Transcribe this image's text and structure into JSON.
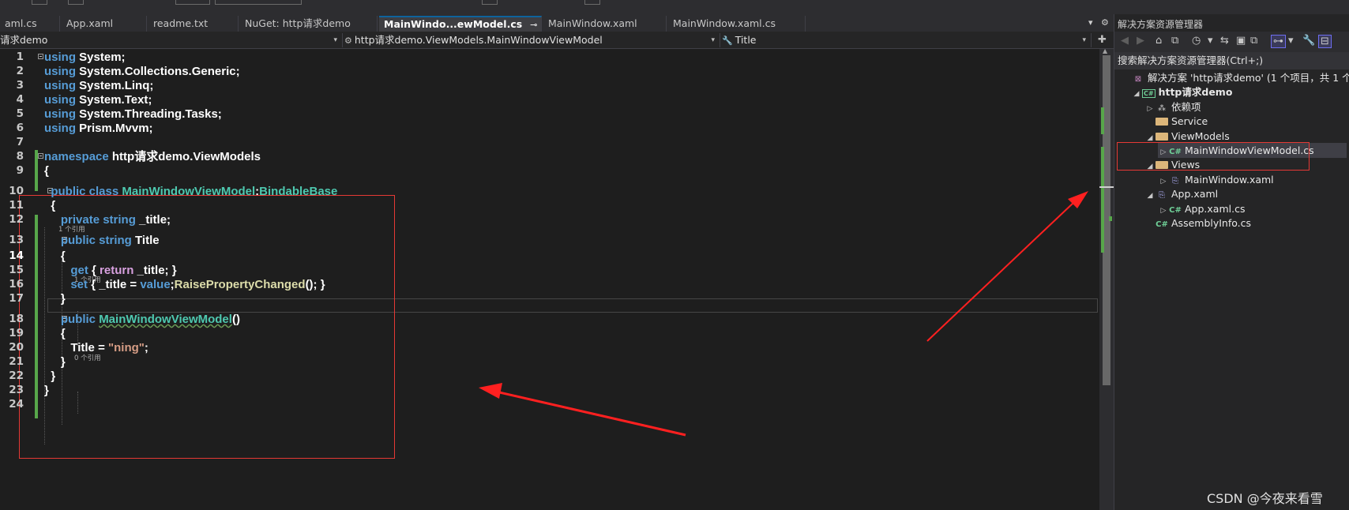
{
  "tabs": [
    {
      "label": "aml.cs",
      "active": false
    },
    {
      "label": "App.xaml",
      "active": false
    },
    {
      "label": "readme.txt",
      "active": false
    },
    {
      "label": "NuGet: http请求demo",
      "active": false
    },
    {
      "label": "MainWindo...ewModel.cs",
      "active": true
    },
    {
      "label": "MainWindow.xaml",
      "active": false
    },
    {
      "label": "MainWindow.xaml.cs",
      "active": false
    }
  ],
  "tab_controls": {
    "pin": "⊸",
    "close": "✕",
    "menu": "▾",
    "settings": "⚙"
  },
  "navbar": {
    "project": "请求demo",
    "class": "http请求demo.ViewModels.MainWindowViewModel",
    "member": "Title",
    "class_icon": "⚙",
    "member_icon": "🔧",
    "caret": "▾",
    "split": "✚"
  },
  "code_lines": [
    {
      "n": "1",
      "html": "<span class=\"kw\">using</span> System;"
    },
    {
      "n": "2",
      "html": "<span class=\"kw\">using</span> System.Collections.Generic;"
    },
    {
      "n": "3",
      "html": "<span class=\"kw\">using</span> System.Linq;"
    },
    {
      "n": "4",
      "html": "<span class=\"kw\">using</span> System.Text;"
    },
    {
      "n": "5",
      "html": "<span class=\"kw\">using</span> System.Threading.Tasks;"
    },
    {
      "n": "6",
      "html": "<span class=\"kw\">using</span> Prism.Mvvm;"
    },
    {
      "n": "7",
      "html": ""
    },
    {
      "n": "8",
      "html": "<span class=\"kw\">namespace</span> http请求demo.ViewModels"
    },
    {
      "n": "9",
      "html": "{"
    },
    {
      "n": "10",
      "html": "  <span class=\"kw\">public class</span> <span class=\"ty\">MainWindowViewModel</span>:<span class=\"ty\">BindableBase</span>"
    },
    {
      "n": "11",
      "html": "  {"
    },
    {
      "n": "12",
      "html": "     <span class=\"kw\">private string</span> _title;"
    },
    {
      "n": "13",
      "html": "     <span class=\"kw\">public string</span> Title"
    },
    {
      "n": "14",
      "html": "     {"
    },
    {
      "n": "15",
      "html": "        <span class=\"kw\">get</span> { <span class=\"kw2\">return</span> _title; }"
    },
    {
      "n": "16",
      "html": "        <span class=\"kw\">set</span> { _title = <span class=\"kw\">value</span>;<span class=\"fn\">RaisePropertyChanged</span>(); }"
    },
    {
      "n": "17",
      "html": "     }"
    },
    {
      "n": "18",
      "html": "     <span class=\"kw\">public</span> <span class=\"ty squig\">MainWindowViewModel</span>()"
    },
    {
      "n": "19",
      "html": "     {"
    },
    {
      "n": "20",
      "html": "        Title = <span class=\"str\">\"ning\"</span>;"
    },
    {
      "n": "21",
      "html": "     }"
    },
    {
      "n": "22",
      "html": "  }"
    },
    {
      "n": "23",
      "html": "}"
    },
    {
      "n": "24",
      "html": ""
    }
  ],
  "codelens": {
    "line10": "1 个引用",
    "line13": "1 个引用",
    "line18": "0 个引用"
  },
  "solution_explorer": {
    "title": "解决方案资源管理器",
    "search_label": "搜索解决方案资源管理器(Ctrl+;)",
    "toolbar": [
      "◀",
      "▶",
      "⌂",
      "⧉",
      "◷",
      "▾",
      "⇆",
      "▣",
      "⧉",
      "⊶",
      "▾",
      "🔧",
      "⊟"
    ],
    "tree": [
      {
        "label": "解决方案 'http请求demo' (1 个项目，共 1 个)",
        "icon": "⊠",
        "iconClass": "sln",
        "exp": "",
        "indent": 0,
        "bold": false
      },
      {
        "label": "http请求demo",
        "icon": "C#",
        "iconClass": "proj",
        "exp": "◢",
        "indent": 1,
        "bold": true
      },
      {
        "label": "依赖项",
        "icon": "⁂",
        "iconClass": "deps",
        "exp": "▷",
        "indent": 2,
        "bold": false
      },
      {
        "label": "Service",
        "icon": "",
        "iconClass": "folder",
        "exp": "",
        "indent": 2,
        "bold": false
      },
      {
        "label": "ViewModels",
        "icon": "",
        "iconClass": "folder",
        "exp": "◢",
        "indent": 2,
        "bold": false
      },
      {
        "label": "MainWindowViewModel.cs",
        "icon": "C#",
        "iconClass": "cs",
        "exp": "▷",
        "indent": 3,
        "bold": false,
        "selected": true
      },
      {
        "label": "Views",
        "icon": "",
        "iconClass": "folder",
        "exp": "◢",
        "indent": 2,
        "bold": false
      },
      {
        "label": "MainWindow.xaml",
        "icon": "⎘",
        "iconClass": "xaml",
        "exp": "▷",
        "indent": 3,
        "bold": false
      },
      {
        "label": "App.xaml",
        "icon": "⎘",
        "iconClass": "xaml",
        "exp": "◢",
        "indent": 2,
        "bold": false
      },
      {
        "label": "App.xaml.cs",
        "icon": "C#",
        "iconClass": "cs",
        "exp": "▷",
        "indent": 3,
        "bold": false
      },
      {
        "label": "AssemblyInfo.cs",
        "icon": "C#",
        "iconClass": "cs",
        "exp": "",
        "indent": 2,
        "bold": false
      }
    ]
  },
  "watermark": "CSDN @今夜来看雪",
  "colors": {
    "highlight_box": "#e53935",
    "arrow": "#ff2020",
    "change_bar": "#57a64a",
    "keyword": "#569cd6",
    "type": "#4ec9b0"
  }
}
